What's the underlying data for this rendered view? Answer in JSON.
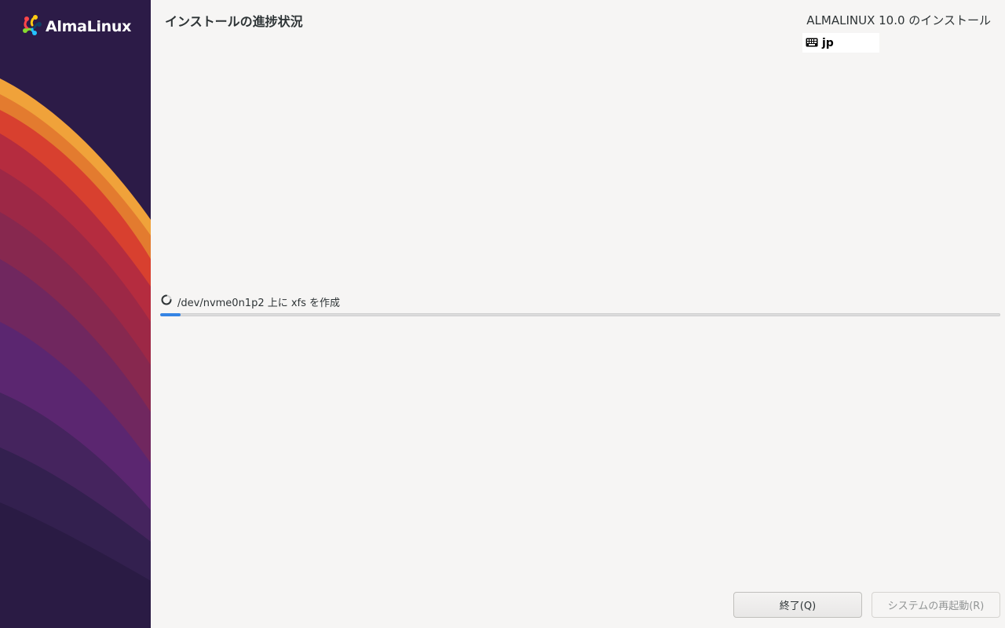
{
  "sidebar": {
    "brand_name": "AlmaLinux",
    "logo_icon": "almalinux-logo-icon"
  },
  "header": {
    "page_title": "インストールの進捗状況",
    "product_title": "ALMALINUX 10.0 のインストール",
    "keyboard_layout": "jp",
    "keyboard_icon": "keyboard-icon"
  },
  "progress": {
    "status_text": "/dev/nvme0n1p2 上に xfs を作成",
    "spinner_icon": "spinner-icon",
    "fraction": 0.024
  },
  "buttons": {
    "quit_label": "終了(Q)",
    "reboot_label": "システムの再起動(R)",
    "reboot_enabled": false
  },
  "colors": {
    "accent": "#3584e4",
    "sidebar_bg": "#2c1b47",
    "page_bg": "#f6f5f4"
  }
}
